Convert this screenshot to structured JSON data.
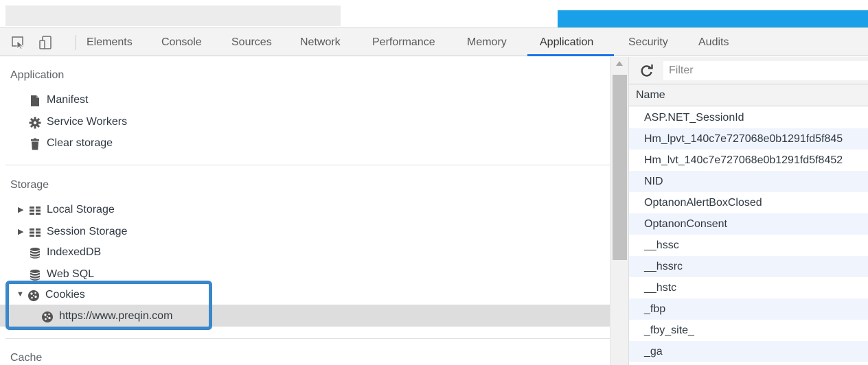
{
  "devtools": {
    "tabs": [
      {
        "label": "Elements"
      },
      {
        "label": "Console"
      },
      {
        "label": "Sources"
      },
      {
        "label": "Network"
      },
      {
        "label": "Performance"
      },
      {
        "label": "Memory"
      },
      {
        "label": "Application",
        "active": true
      },
      {
        "label": "Security"
      },
      {
        "label": "Audits"
      }
    ],
    "accent_color": "#1a73e8"
  },
  "sidebar": {
    "application": {
      "title": "Application",
      "items": [
        {
          "label": "Manifest",
          "icon": "document-icon"
        },
        {
          "label": "Service Workers",
          "icon": "gear-icon"
        },
        {
          "label": "Clear storage",
          "icon": "trash-icon"
        }
      ]
    },
    "storage": {
      "title": "Storage",
      "items": [
        {
          "label": "Local Storage",
          "icon": "grid-icon",
          "expandable": true
        },
        {
          "label": "Session Storage",
          "icon": "grid-icon",
          "expandable": true
        },
        {
          "label": "IndexedDB",
          "icon": "database-icon"
        },
        {
          "label": "Web SQL",
          "icon": "database-icon"
        },
        {
          "label": "Cookies",
          "icon": "cookie-icon",
          "expanded": true
        },
        {
          "label": "https://www.preqin.com",
          "icon": "cookie-icon",
          "selected": true
        }
      ]
    },
    "cache": {
      "title": "Cache"
    },
    "highlight_color": "#3a87c9"
  },
  "cookies_table": {
    "filter_placeholder": "Filter",
    "column_name": "Name",
    "rows": [
      "ASP.NET_SessionId",
      "Hm_lpvt_140c7e727068e0b1291fd5f845",
      "Hm_lvt_140c7e727068e0b1291fd5f8452",
      "NID",
      "OptanonAlertBoxClosed",
      "OptanonConsent",
      "__hssc",
      "__hssrc",
      "__hstc",
      "_fbp",
      "_fby_site_",
      "_ga"
    ]
  }
}
